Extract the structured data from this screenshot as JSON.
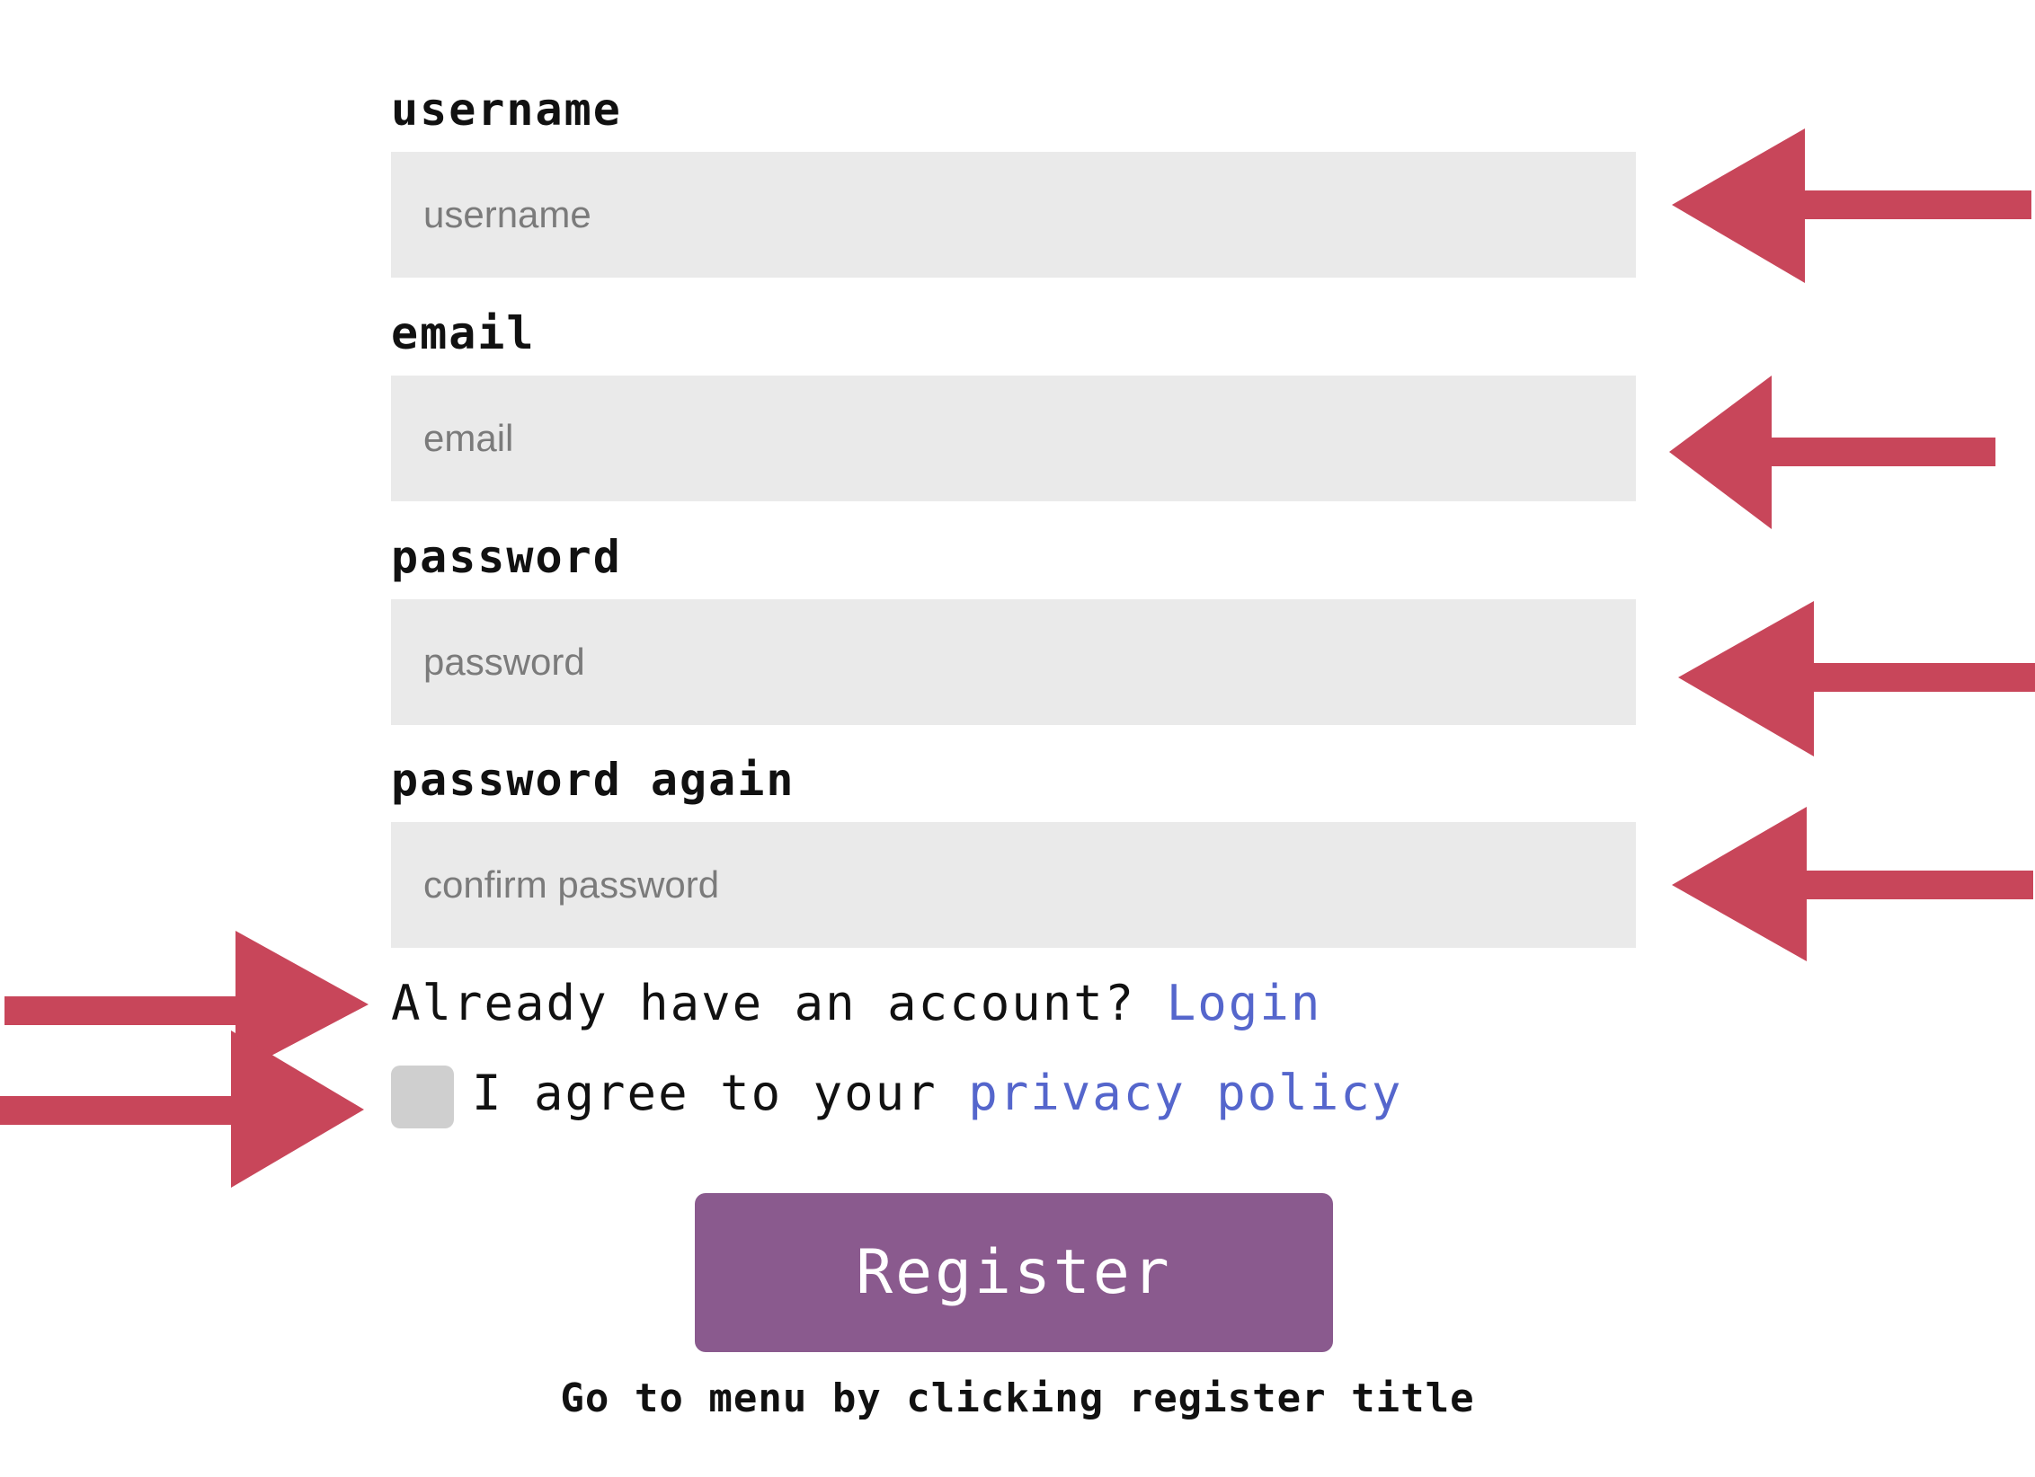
{
  "form": {
    "username": {
      "label": "username",
      "placeholder": "username",
      "value": ""
    },
    "email": {
      "label": "email",
      "placeholder": "email",
      "value": ""
    },
    "password": {
      "label": "password",
      "placeholder": "password",
      "value": ""
    },
    "password_again": {
      "label": "password again",
      "placeholder": "confirm password",
      "value": ""
    },
    "login_prompt": "Already have an account?",
    "login_link": "Login",
    "agree_text": "I agree to your",
    "privacy_link": "privacy policy",
    "agree_checked": false,
    "register_label": "Register",
    "footer_hint": "Go to menu by clicking register title"
  },
  "annotations": {
    "arrow_color": "#c8465a"
  },
  "colors": {
    "field_bg": "#eaeaea",
    "button_bg": "#8a5a8e",
    "link": "#5566cc",
    "checkbox_bg": "#cfcfcf"
  }
}
